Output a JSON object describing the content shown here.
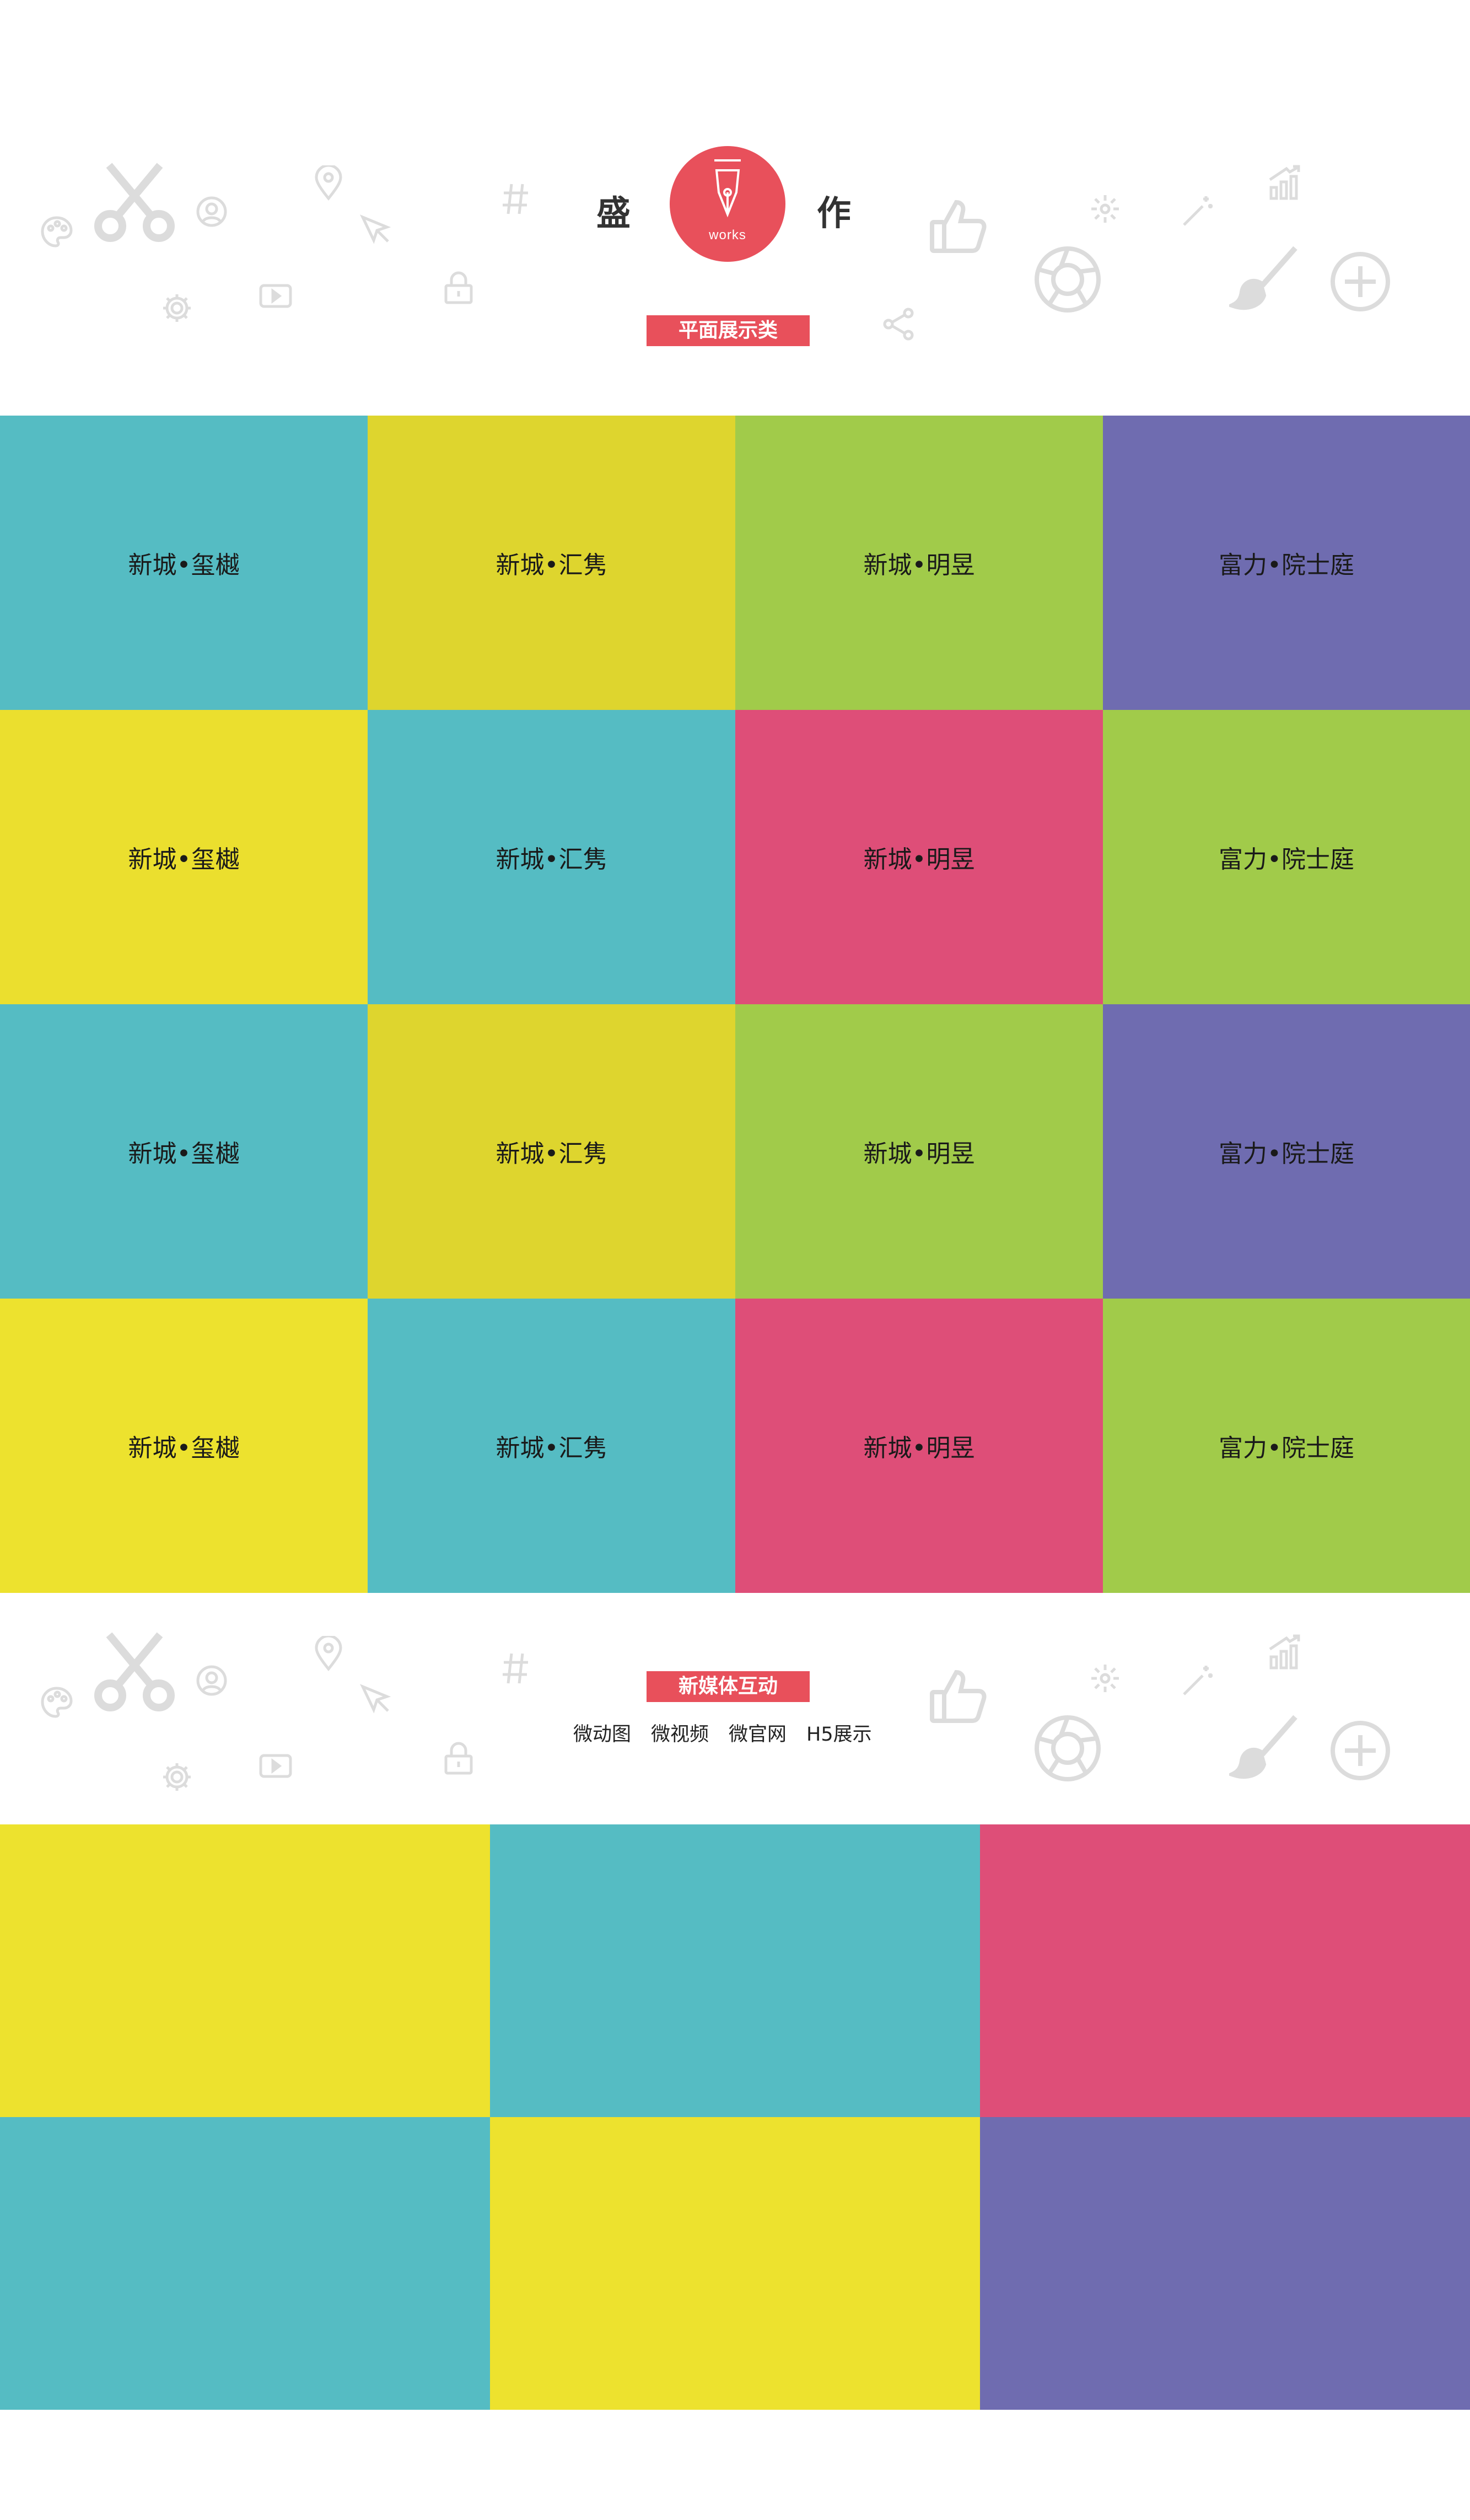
{
  "header": {
    "title_left": "盛",
    "title_right": "作",
    "logo_word": "works",
    "category_label": "平面展示类"
  },
  "colors": {
    "accent": "#e8505b",
    "teal": "#55bcc3",
    "mustard": "#ded52e",
    "lime": "#a1cb4a",
    "purple": "#6f6cb0",
    "yellow": "#ede22e",
    "pink": "#de4e78"
  },
  "print_grid": {
    "tiles": [
      {
        "label": "新城•玺樾",
        "color": "#55bcc3"
      },
      {
        "label": "新城•汇隽",
        "color": "#ded52e"
      },
      {
        "label": "新城•明昱",
        "color": "#a1cb4a"
      },
      {
        "label": "富力•院士庭",
        "color": "#6f6cb0"
      },
      {
        "label": "新城•玺樾",
        "color": "#ebdf2e"
      },
      {
        "label": "新城•汇隽",
        "color": "#55bcc3"
      },
      {
        "label": "新城•明昱",
        "color": "#de4e78"
      },
      {
        "label": "富力•院士庭",
        "color": "#a1cb4a"
      },
      {
        "label": "新城•玺樾",
        "color": "#55bcc3"
      },
      {
        "label": "新城•汇隽",
        "color": "#ded52e"
      },
      {
        "label": "新城•明昱",
        "color": "#a1cb4a"
      },
      {
        "label": "富力•院士庭",
        "color": "#6f6cb0"
      },
      {
        "label": "新城•玺樾",
        "color": "#ede22e"
      },
      {
        "label": "新城•汇隽",
        "color": "#55bcc3"
      },
      {
        "label": "新城•明昱",
        "color": "#de4e78"
      },
      {
        "label": "富力•院士庭",
        "color": "#a1cb4a"
      }
    ]
  },
  "media_section": {
    "category_label": "新媒体互动",
    "sub_nav": [
      "微动图",
      "微视频",
      "微官网",
      "H5展示"
    ]
  },
  "media_grid": {
    "tiles": [
      {
        "color": "#ede22e"
      },
      {
        "color": "#55bcc3"
      },
      {
        "color": "#de4e78"
      },
      {
        "color": "#55bcc3"
      },
      {
        "color": "#ede22e"
      },
      {
        "color": "#6f6cb0"
      }
    ]
  },
  "icons": [
    "palette-icon",
    "scissors-icon",
    "user-circle-icon",
    "location-pin-icon",
    "cursor-icon",
    "settings-icon",
    "play-icon",
    "lock-icon",
    "hash-icon",
    "thumbs-up-icon",
    "sparkle-icon",
    "magic-wand-icon",
    "growth-chart-icon",
    "camera-aperture-icon",
    "brush-icon",
    "plus-circle-icon",
    "share-icon",
    "fountain-pen-icon"
  ]
}
